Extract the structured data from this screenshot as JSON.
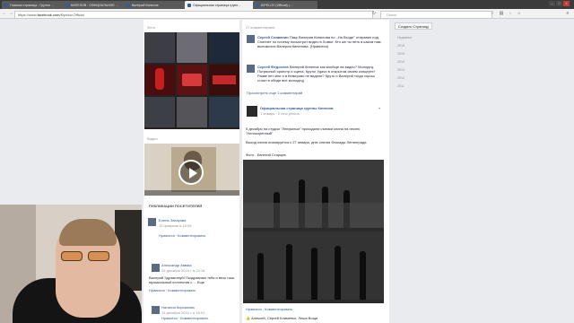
{
  "tabs": [
    {
      "label": "Главная страница - Группа ...",
      "color": "#3b5998"
    },
    {
      "label": "КИПЕЛОВ - ОФИЦИАЛЬНОЕ ...",
      "color": "#3b5998"
    },
    {
      "label": "Валерий Кипелов",
      "color": "#3b5998"
    },
    {
      "label": "Официальная страница групп...",
      "color": "#3b5998"
    },
    {
      "label": "KIPELOV (Official) | ...",
      "color": "#3b5998"
    }
  ],
  "address": {
    "prefix": "https://www.",
    "host": "facebook.com",
    "path": "/Kipelov.Official"
  },
  "search": {
    "placeholder": "Поиск"
  },
  "left": {
    "photos_label": "Фото",
    "video_label": "Видео",
    "posts_by_others": "ПУБЛИКАЦИИ ПОСЕТИТЕЛЕЙ",
    "visitor_posts": [
      {
        "author": "Елена Захарова",
        "meta": "15 февраля в 15:05",
        "actions": "Нравится · Комментировать"
      },
      {
        "author": "Александр Аввакс",
        "meta": "26 декабря 2015 г. в 22:18",
        "body": "Валерий Здравствуй! Поздравляю тебя и весь наш музыкальный коллектив с ... Еще",
        "actions": "Нравится · Комментировать"
      },
      {
        "author": "Наталия Кирсанова",
        "meta": "24 декабря 2015 г. в 16:01",
        "actions": "Нравится · Комментировать"
      }
    ]
  },
  "main": {
    "comments_count": "27 комментариев",
    "comments": [
      {
        "author": "Сергей Славянин",
        "text": "Пакр Валерия Кипелова по ,,На Входе'' отправил под Сниппет но почему посмотрит видео в Ломке. Кто же ты петь в каком нам выложится Валерия Кипелова. (Нравится)"
      },
      {
        "author": "Сергей Федосеев",
        "text": "Валерий Кипелов как вообще на видео? Молодец. Потрясный оркестр и сцена. Круто! Удачи в открытом своем концерте! Разве нет мне и в Кемерово не видели? Круто и Валерий тогда хорош стоял в обиде все молодец)"
      }
    ],
    "more_comments": "Просмотреть еще 1 комментарий",
    "post": {
      "page_name": "Официальная страница группы Кипелов",
      "meta": "1 января · 2 new photos",
      "text": "5 декабря на студии \"Ленфильм\" проходили съемки клипа на песню \"Непокоренный\"",
      "image_caption": "Выход клипа планируется к 27 января, дню снятия блокады Ленинграда",
      "photo_credit": "Фото - Евгений Старцев",
      "actions": "Нравится · Комментировать",
      "likes": "Алексей, Сергей Клименко, Леша Вощи"
    }
  },
  "right": {
    "create_page": "Создать Страницу",
    "years": [
      "Недавние",
      "2016",
      "2015",
      "2014",
      "2013",
      "2012",
      "2011"
    ]
  },
  "colors": {
    "facebook_blue": "#3b5998",
    "link": "#365899",
    "page_bg": "#e9ebee"
  }
}
